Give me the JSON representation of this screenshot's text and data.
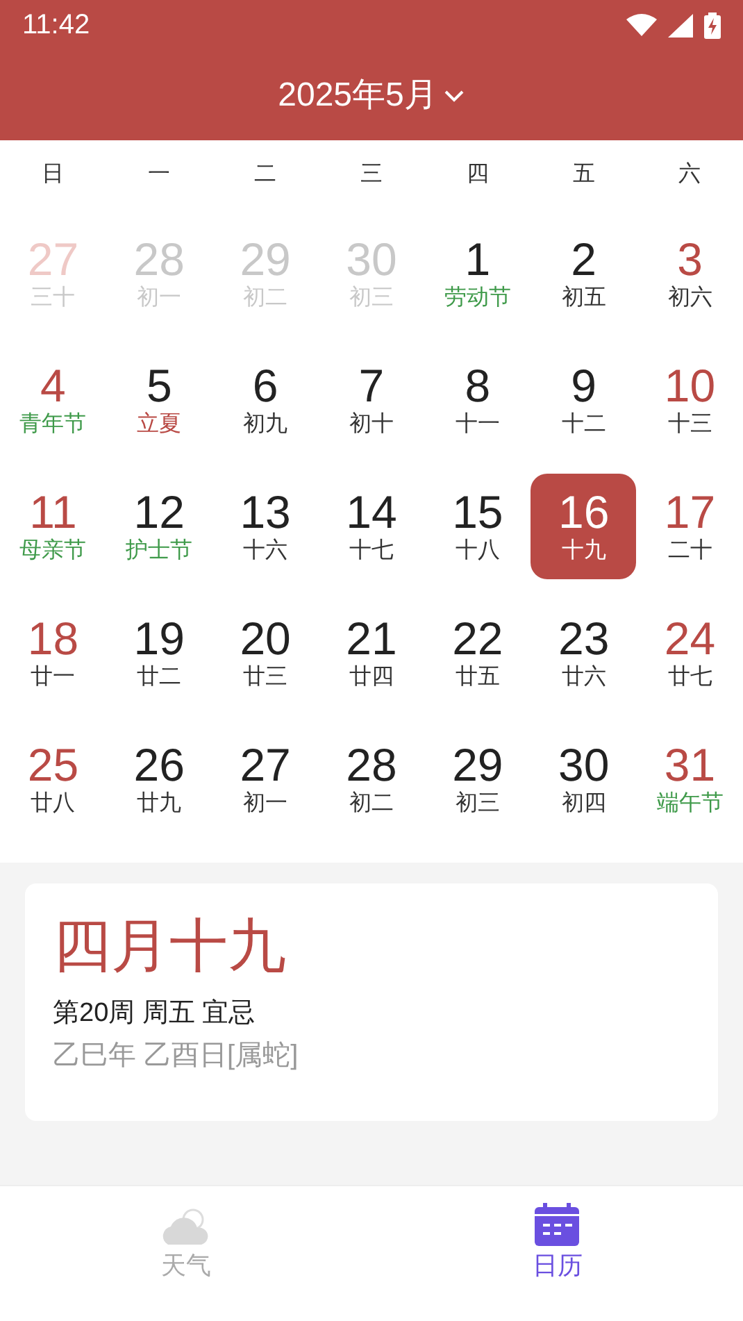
{
  "status_bar": {
    "time": "11:42"
  },
  "header": {
    "title": "2025年5月"
  },
  "weekdays": [
    "日",
    "一",
    "二",
    "三",
    "四",
    "五",
    "六"
  ],
  "days": [
    {
      "day": "27",
      "lunar": {
        "text": "三十",
        "kind": "lunar"
      },
      "kind": "outside_weekend",
      "selected": false
    },
    {
      "day": "28",
      "lunar": {
        "text": "初一",
        "kind": "lunar"
      },
      "kind": "outside",
      "selected": false
    },
    {
      "day": "29",
      "lunar": {
        "text": "初二",
        "kind": "lunar"
      },
      "kind": "outside",
      "selected": false
    },
    {
      "day": "30",
      "lunar": {
        "text": "初三",
        "kind": "lunar"
      },
      "kind": "outside",
      "selected": false
    },
    {
      "day": "1",
      "lunar": {
        "text": "劳动节",
        "kind": "festival"
      },
      "kind": "weekday",
      "selected": false
    },
    {
      "day": "2",
      "lunar": {
        "text": "初五",
        "kind": "lunar"
      },
      "kind": "weekday",
      "selected": false
    },
    {
      "day": "3",
      "lunar": {
        "text": "初六",
        "kind": "lunar"
      },
      "kind": "weekend",
      "selected": false
    },
    {
      "day": "4",
      "lunar": {
        "text": "青年节",
        "kind": "festival"
      },
      "kind": "weekend",
      "selected": false
    },
    {
      "day": "5",
      "lunar": {
        "text": "立夏",
        "kind": "solar_term"
      },
      "kind": "weekday",
      "selected": false
    },
    {
      "day": "6",
      "lunar": {
        "text": "初九",
        "kind": "lunar"
      },
      "kind": "weekday",
      "selected": false
    },
    {
      "day": "7",
      "lunar": {
        "text": "初十",
        "kind": "lunar"
      },
      "kind": "weekday",
      "selected": false
    },
    {
      "day": "8",
      "lunar": {
        "text": "十一",
        "kind": "lunar"
      },
      "kind": "weekday",
      "selected": false
    },
    {
      "day": "9",
      "lunar": {
        "text": "十二",
        "kind": "lunar"
      },
      "kind": "weekday",
      "selected": false
    },
    {
      "day": "10",
      "lunar": {
        "text": "十三",
        "kind": "lunar"
      },
      "kind": "weekend",
      "selected": false
    },
    {
      "day": "11",
      "lunar": {
        "text": "母亲节",
        "kind": "festival"
      },
      "kind": "weekend",
      "selected": false
    },
    {
      "day": "12",
      "lunar": {
        "text": "护士节",
        "kind": "festival"
      },
      "kind": "weekday",
      "selected": false
    },
    {
      "day": "13",
      "lunar": {
        "text": "十六",
        "kind": "lunar"
      },
      "kind": "weekday",
      "selected": false
    },
    {
      "day": "14",
      "lunar": {
        "text": "十七",
        "kind": "lunar"
      },
      "kind": "weekday",
      "selected": false
    },
    {
      "day": "15",
      "lunar": {
        "text": "十八",
        "kind": "lunar"
      },
      "kind": "weekday",
      "selected": false
    },
    {
      "day": "16",
      "lunar": {
        "text": "十九",
        "kind": "lunar"
      },
      "kind": "weekday",
      "selected": true
    },
    {
      "day": "17",
      "lunar": {
        "text": "二十",
        "kind": "lunar"
      },
      "kind": "weekend",
      "selected": false
    },
    {
      "day": "18",
      "lunar": {
        "text": "廿一",
        "kind": "lunar"
      },
      "kind": "weekend",
      "selected": false
    },
    {
      "day": "19",
      "lunar": {
        "text": "廿二",
        "kind": "lunar"
      },
      "kind": "weekday",
      "selected": false
    },
    {
      "day": "20",
      "lunar": {
        "text": "廿三",
        "kind": "lunar"
      },
      "kind": "weekday",
      "selected": false
    },
    {
      "day": "21",
      "lunar": {
        "text": "廿四",
        "kind": "lunar"
      },
      "kind": "weekday",
      "selected": false
    },
    {
      "day": "22",
      "lunar": {
        "text": "廿五",
        "kind": "lunar"
      },
      "kind": "weekday",
      "selected": false
    },
    {
      "day": "23",
      "lunar": {
        "text": "廿六",
        "kind": "lunar"
      },
      "kind": "weekday",
      "selected": false
    },
    {
      "day": "24",
      "lunar": {
        "text": "廿七",
        "kind": "lunar"
      },
      "kind": "weekend",
      "selected": false
    },
    {
      "day": "25",
      "lunar": {
        "text": "廿八",
        "kind": "lunar"
      },
      "kind": "weekend",
      "selected": false
    },
    {
      "day": "26",
      "lunar": {
        "text": "廿九",
        "kind": "lunar"
      },
      "kind": "weekday",
      "selected": false
    },
    {
      "day": "27",
      "lunar": {
        "text": "初一",
        "kind": "lunar"
      },
      "kind": "weekday",
      "selected": false
    },
    {
      "day": "28",
      "lunar": {
        "text": "初二",
        "kind": "lunar"
      },
      "kind": "weekday",
      "selected": false
    },
    {
      "day": "29",
      "lunar": {
        "text": "初三",
        "kind": "lunar"
      },
      "kind": "weekday",
      "selected": false
    },
    {
      "day": "30",
      "lunar": {
        "text": "初四",
        "kind": "lunar"
      },
      "kind": "weekday",
      "selected": false
    },
    {
      "day": "31",
      "lunar": {
        "text": "端午节",
        "kind": "festival"
      },
      "kind": "weekend",
      "selected": false
    }
  ],
  "detail": {
    "lunar_date": "四月十九",
    "week_info": "第20周 周五 宜忌",
    "ganzhi": "乙巳年 乙酉日[属蛇]"
  },
  "bottom_nav": [
    {
      "label": "天气",
      "kind": "weather",
      "selected": false
    },
    {
      "label": "日历",
      "kind": "calendar",
      "selected": true
    }
  ]
}
